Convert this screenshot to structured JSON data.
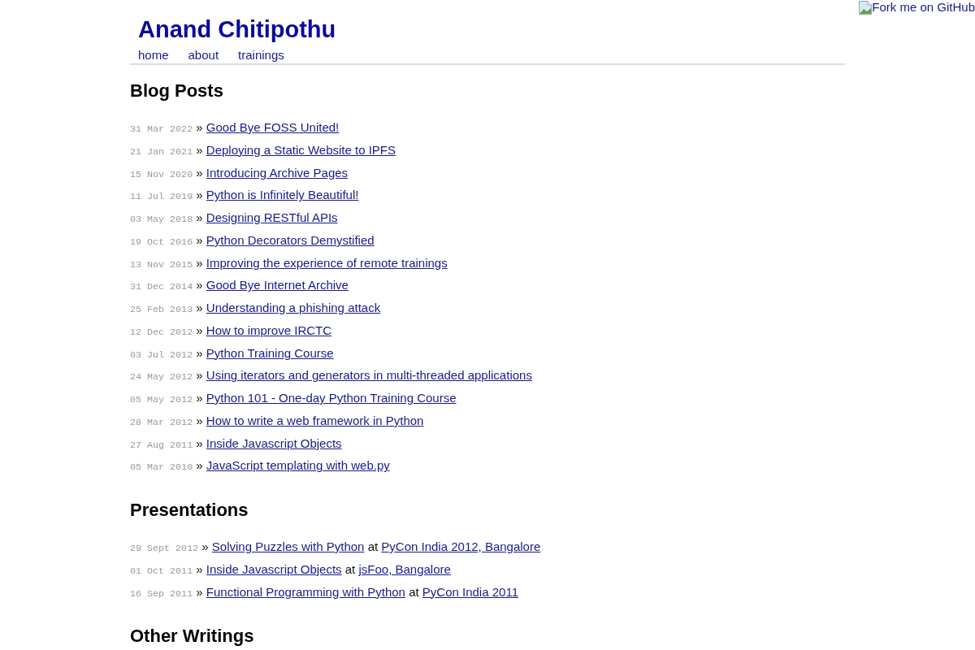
{
  "site": {
    "title": "Anand Chitipothu",
    "nav": [
      {
        "label": "home"
      },
      {
        "label": "about"
      },
      {
        "label": "trainings"
      }
    ]
  },
  "fork_ribbon": {
    "text": "Fork me on GitHub"
  },
  "sections": [
    {
      "heading": "Blog Posts",
      "items": [
        {
          "date": "31 Mar 2022",
          "separator": "»",
          "title": "Good Bye FOSS United!"
        },
        {
          "date": "21 Jan 2021",
          "separator": "»",
          "title": "Deploying a Static Website to IPFS"
        },
        {
          "date": "15 Nov 2020",
          "separator": "»",
          "title": "Introducing Archive Pages"
        },
        {
          "date": "11 Jul 2019",
          "separator": "»",
          "title": "Python is Infinitely Beautiful!"
        },
        {
          "date": "03 May 2018",
          "separator": "»",
          "title": "Designing RESTful APIs"
        },
        {
          "date": "19 Oct 2016",
          "separator": "»",
          "title": "Python Decorators Demystified"
        },
        {
          "date": "13 Nov 2015",
          "separator": "»",
          "title": "Improving the experience of remote trainings"
        },
        {
          "date": "31 Dec 2014",
          "separator": "»",
          "title": "Good Bye Internet Archive"
        },
        {
          "date": "25 Feb 2013",
          "separator": "»",
          "title": "Understanding a phishing attack"
        },
        {
          "date": "12 Dec 2012",
          "separator": "»",
          "title": "How to improve IRCTC"
        },
        {
          "date": "03 Jul 2012",
          "separator": "»",
          "title": "Python Training Course"
        },
        {
          "date": "24 May 2012",
          "separator": "»",
          "title": "Using iterators and generators in multi-threaded applications"
        },
        {
          "date": "05 May 2012",
          "separator": "»",
          "title": "Python 101 - One-day Python Training Course"
        },
        {
          "date": "28 Mar 2012",
          "separator": "»",
          "title": "How to write a web framework in Python"
        },
        {
          "date": "27 Aug 2011",
          "separator": "»",
          "title": "Inside Javascript Objects"
        },
        {
          "date": "05 Mar 2010",
          "separator": "»",
          "title": "JavaScript templating with web.py"
        }
      ]
    },
    {
      "heading": "Presentations",
      "items": [
        {
          "date": "29 Sept 2012",
          "separator": "»",
          "title": "Solving Puzzles with Python",
          "connector": "at",
          "venue": "PyCon India 2012, Bangalore"
        },
        {
          "date": "01 Oct 2011",
          "separator": "»",
          "title": "Inside Javascript Objects",
          "connector": "at",
          "venue": "jsFoo, Bangalore"
        },
        {
          "date": "16 Sep 2011",
          "separator": "»",
          "title": "Functional Programming with Python",
          "connector": "at",
          "venue": "PyCon India 2011"
        }
      ]
    },
    {
      "heading": "Other Writings"
    }
  ]
}
